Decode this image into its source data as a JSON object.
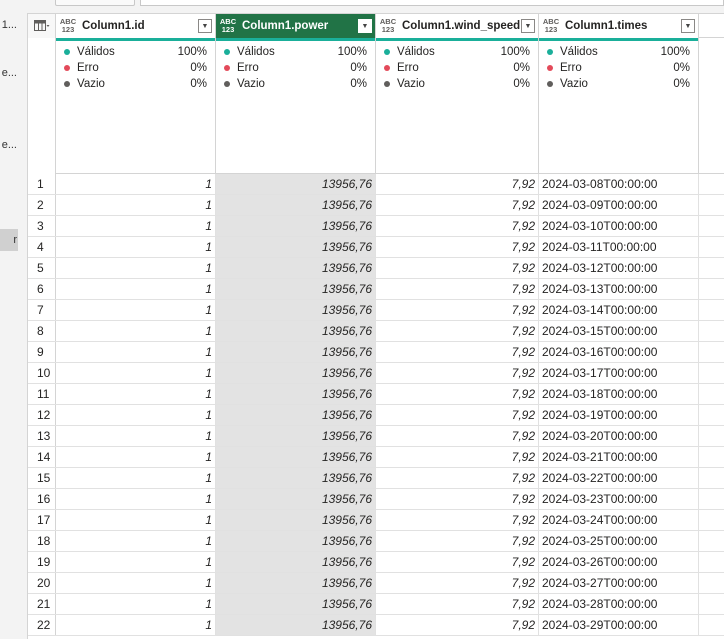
{
  "left_pane": {
    "items": [
      {
        "label": "1..."
      },
      {
        "label": "e..."
      },
      {
        "label": "e..."
      },
      {
        "label": "r"
      }
    ]
  },
  "columns": [
    {
      "type_icon": "ABC\n123",
      "name": "Column1.id",
      "selected": false
    },
    {
      "type_icon": "ABC\n123",
      "name": "Column1.power",
      "selected": true
    },
    {
      "type_icon": "ABC\n123",
      "name": "Column1.wind_speed",
      "selected": false
    },
    {
      "type_icon": "ABC\n123",
      "name": "Column1.times",
      "selected": false
    }
  ],
  "quality": {
    "labels": {
      "valid": "Válidos",
      "error": "Erro",
      "empty": "Vazio"
    },
    "values": [
      {
        "valid": "100%",
        "error": "0%",
        "empty": "0%"
      },
      {
        "valid": "100%",
        "error": "0%",
        "empty": "0%"
      },
      {
        "valid": "100%",
        "error": "0%",
        "empty": "0%"
      },
      {
        "valid": "100%",
        "error": "0%",
        "empty": "0%"
      }
    ]
  },
  "rows": [
    {
      "n": "1",
      "id": "1",
      "power": "13956,76",
      "wind_speed": "7,92",
      "times": "2024-03-08T00:00:00"
    },
    {
      "n": "2",
      "id": "1",
      "power": "13956,76",
      "wind_speed": "7,92",
      "times": "2024-03-09T00:00:00"
    },
    {
      "n": "3",
      "id": "1",
      "power": "13956,76",
      "wind_speed": "7,92",
      "times": "2024-03-10T00:00:00"
    },
    {
      "n": "4",
      "id": "1",
      "power": "13956,76",
      "wind_speed": "7,92",
      "times": "2024-03-11T00:00:00"
    },
    {
      "n": "5",
      "id": "1",
      "power": "13956,76",
      "wind_speed": "7,92",
      "times": "2024-03-12T00:00:00"
    },
    {
      "n": "6",
      "id": "1",
      "power": "13956,76",
      "wind_speed": "7,92",
      "times": "2024-03-13T00:00:00"
    },
    {
      "n": "7",
      "id": "1",
      "power": "13956,76",
      "wind_speed": "7,92",
      "times": "2024-03-14T00:00:00"
    },
    {
      "n": "8",
      "id": "1",
      "power": "13956,76",
      "wind_speed": "7,92",
      "times": "2024-03-15T00:00:00"
    },
    {
      "n": "9",
      "id": "1",
      "power": "13956,76",
      "wind_speed": "7,92",
      "times": "2024-03-16T00:00:00"
    },
    {
      "n": "10",
      "id": "1",
      "power": "13956,76",
      "wind_speed": "7,92",
      "times": "2024-03-17T00:00:00"
    },
    {
      "n": "11",
      "id": "1",
      "power": "13956,76",
      "wind_speed": "7,92",
      "times": "2024-03-18T00:00:00"
    },
    {
      "n": "12",
      "id": "1",
      "power": "13956,76",
      "wind_speed": "7,92",
      "times": "2024-03-19T00:00:00"
    },
    {
      "n": "13",
      "id": "1",
      "power": "13956,76",
      "wind_speed": "7,92",
      "times": "2024-03-20T00:00:00"
    },
    {
      "n": "14",
      "id": "1",
      "power": "13956,76",
      "wind_speed": "7,92",
      "times": "2024-03-21T00:00:00"
    },
    {
      "n": "15",
      "id": "1",
      "power": "13956,76",
      "wind_speed": "7,92",
      "times": "2024-03-22T00:00:00"
    },
    {
      "n": "16",
      "id": "1",
      "power": "13956,76",
      "wind_speed": "7,92",
      "times": "2024-03-23T00:00:00"
    },
    {
      "n": "17",
      "id": "1",
      "power": "13956,76",
      "wind_speed": "7,92",
      "times": "2024-03-24T00:00:00"
    },
    {
      "n": "18",
      "id": "1",
      "power": "13956,76",
      "wind_speed": "7,92",
      "times": "2024-03-25T00:00:00"
    },
    {
      "n": "19",
      "id": "1",
      "power": "13956,76",
      "wind_speed": "7,92",
      "times": "2024-03-26T00:00:00"
    },
    {
      "n": "20",
      "id": "1",
      "power": "13956,76",
      "wind_speed": "7,92",
      "times": "2024-03-27T00:00:00"
    },
    {
      "n": "21",
      "id": "1",
      "power": "13956,76",
      "wind_speed": "7,92",
      "times": "2024-03-28T00:00:00"
    },
    {
      "n": "22",
      "id": "1",
      "power": "13956,76",
      "wind_speed": "7,92",
      "times": "2024-03-29T00:00:00"
    }
  ],
  "colors": {
    "selected_header": "#217346",
    "quality_bar": "#1aaf9a",
    "error_dot": "#e34a5a",
    "empty_dot": "#605e5c",
    "selected_column_bg": "#e3e3e3"
  },
  "icons": {
    "table_menu": "table-grid-icon",
    "column_dropdown": "chevron-down-icon"
  }
}
